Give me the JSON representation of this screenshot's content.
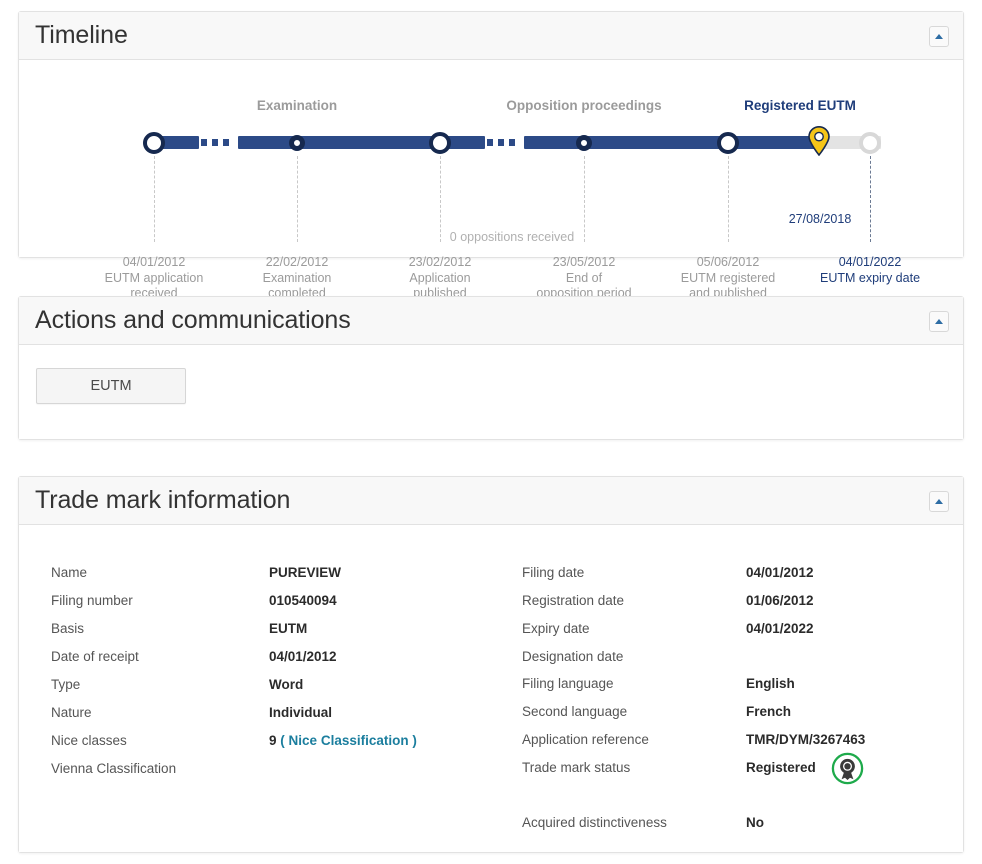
{
  "panels": {
    "timeline": {
      "title": "Timeline",
      "collapse_icon": "caret-up-icon"
    },
    "actions": {
      "title": "Actions and communications",
      "collapse_icon": "caret-up-icon"
    },
    "tminfo": {
      "title": "Trade mark information",
      "collapse_icon": "caret-up-icon"
    }
  },
  "timeline": {
    "phases": [
      {
        "label": "Examination",
        "active": false
      },
      {
        "label": "Opposition proceedings",
        "active": false
      },
      {
        "label": "Registered EUTM",
        "active": true
      }
    ],
    "nodes": [
      {
        "date": "04/01/2012",
        "line1": "EUTM application",
        "line2": "received"
      },
      {
        "date": "22/02/2012",
        "line1": "Examination",
        "line2": "completed"
      },
      {
        "date": "23/02/2012",
        "line1": "Application",
        "line2": "published"
      },
      {
        "date": "23/05/2012",
        "line1": "End of",
        "line2": "opposition period"
      },
      {
        "date": "05/06/2012",
        "line1": "EUTM registered",
        "line2": "and published"
      },
      {
        "date": "04/01/2022",
        "line1": "EUTM expiry date",
        "line2": ""
      }
    ],
    "mid_note": "0 oppositions received",
    "current_marker": {
      "icon": "map-pin-icon",
      "date": "27/08/2018"
    },
    "colors": {
      "track": "#2c4a87",
      "track_inactive": "#e3e3e3",
      "node_border": "#16294f",
      "pin": "#f5c518",
      "active_text": "#1f3d7a",
      "muted_text": "#9b9b9b"
    }
  },
  "actions": {
    "buttons": [
      {
        "label": "EUTM"
      }
    ]
  },
  "tminfo": {
    "left": [
      {
        "label": "Name",
        "value": "PUREVIEW"
      },
      {
        "label": "Filing number",
        "value": "010540094"
      },
      {
        "label": "Basis",
        "value": "EUTM"
      },
      {
        "label": "Date of receipt",
        "value": "04/01/2012"
      },
      {
        "label": "Type",
        "value": "Word"
      },
      {
        "label": "Nature",
        "value": "Individual"
      },
      {
        "label": "Nice classes",
        "value": "9"
      },
      {
        "label": "Vienna Classification",
        "value": ""
      }
    ],
    "nice": {
      "class_number": "9",
      "open_paren": "(",
      "link_text": "Nice Classification",
      "close_paren": ")",
      "link_color": "#1b7e9e"
    },
    "right": [
      {
        "label": "Filing date",
        "value": "04/01/2012"
      },
      {
        "label": "Registration date",
        "value": "01/06/2012"
      },
      {
        "label": "Expiry date",
        "value": "04/01/2022"
      },
      {
        "label": "Designation date",
        "value": ""
      },
      {
        "label": "Filing language",
        "value": "English"
      },
      {
        "label": "Second language",
        "value": "French"
      },
      {
        "label": "Application reference",
        "value": "TMR/DYM/3267463"
      },
      {
        "label": "Trade mark status",
        "value": "Registered"
      },
      {
        "label": "",
        "value": ""
      },
      {
        "label": "Acquired distinctiveness",
        "value": "No"
      }
    ],
    "status_badge": {
      "icon": "award-rosette-icon",
      "color": "#1eaa4b"
    }
  }
}
